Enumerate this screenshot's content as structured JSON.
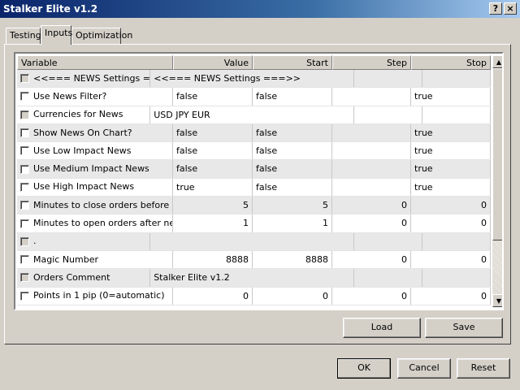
{
  "window": {
    "title": "Stalker Elite v1.2",
    "help_label": "?",
    "close_label": "×"
  },
  "tabs": [
    {
      "label": "Testing",
      "active": false
    },
    {
      "label": "Inputs",
      "active": true
    },
    {
      "label": "Optimization",
      "active": false
    }
  ],
  "grid": {
    "columns": [
      "Variable",
      "Value",
      "Start",
      "Step",
      "Stop"
    ],
    "rows": [
      {
        "variable": "<<=== NEWS Settings ===>>",
        "value": "<<=== NEWS Settings ===>>",
        "start": "",
        "step": "",
        "stop": ""
      },
      {
        "variable": "Use News Filter?",
        "value": "false",
        "start": "false",
        "step": "",
        "stop": "true"
      },
      {
        "variable": "Currencies for News",
        "value": "USD JPY EUR",
        "start": "",
        "step": "",
        "stop": ""
      },
      {
        "variable": "Show News On Chart?",
        "value": "false",
        "start": "false",
        "step": "",
        "stop": "true"
      },
      {
        "variable": "Use Low Impact News",
        "value": "false",
        "start": "false",
        "step": "",
        "stop": "true"
      },
      {
        "variable": "Use Medium Impact News",
        "value": "false",
        "start": "false",
        "step": "",
        "stop": "true"
      },
      {
        "variable": "Use High Impact News",
        "value": "true",
        "start": "false",
        "step": "",
        "stop": "true"
      },
      {
        "variable": "Minutes to close orders before news",
        "value": "5",
        "start": "5",
        "step": "0",
        "stop": "0"
      },
      {
        "variable": "Minutes to open orders after news",
        "value": "1",
        "start": "1",
        "step": "0",
        "stop": "0"
      },
      {
        "variable": ".",
        "value": "",
        "start": "",
        "step": "",
        "stop": ""
      },
      {
        "variable": "Magic Number",
        "value": "8888",
        "start": "8888",
        "step": "0",
        "stop": "0"
      },
      {
        "variable": "Orders Comment",
        "value": "Stalker Elite v1.2",
        "start": "",
        "step": "",
        "stop": ""
      },
      {
        "variable": "Points in 1 pip (0=automatic)",
        "value": "0",
        "start": "0",
        "step": "0",
        "stop": "0"
      }
    ]
  },
  "scrollbar": {
    "up_label": "▲",
    "down_label": "▼"
  },
  "buttons": {
    "load": "Load",
    "save": "Save",
    "ok": "OK",
    "cancel": "Cancel",
    "reset": "Reset"
  }
}
